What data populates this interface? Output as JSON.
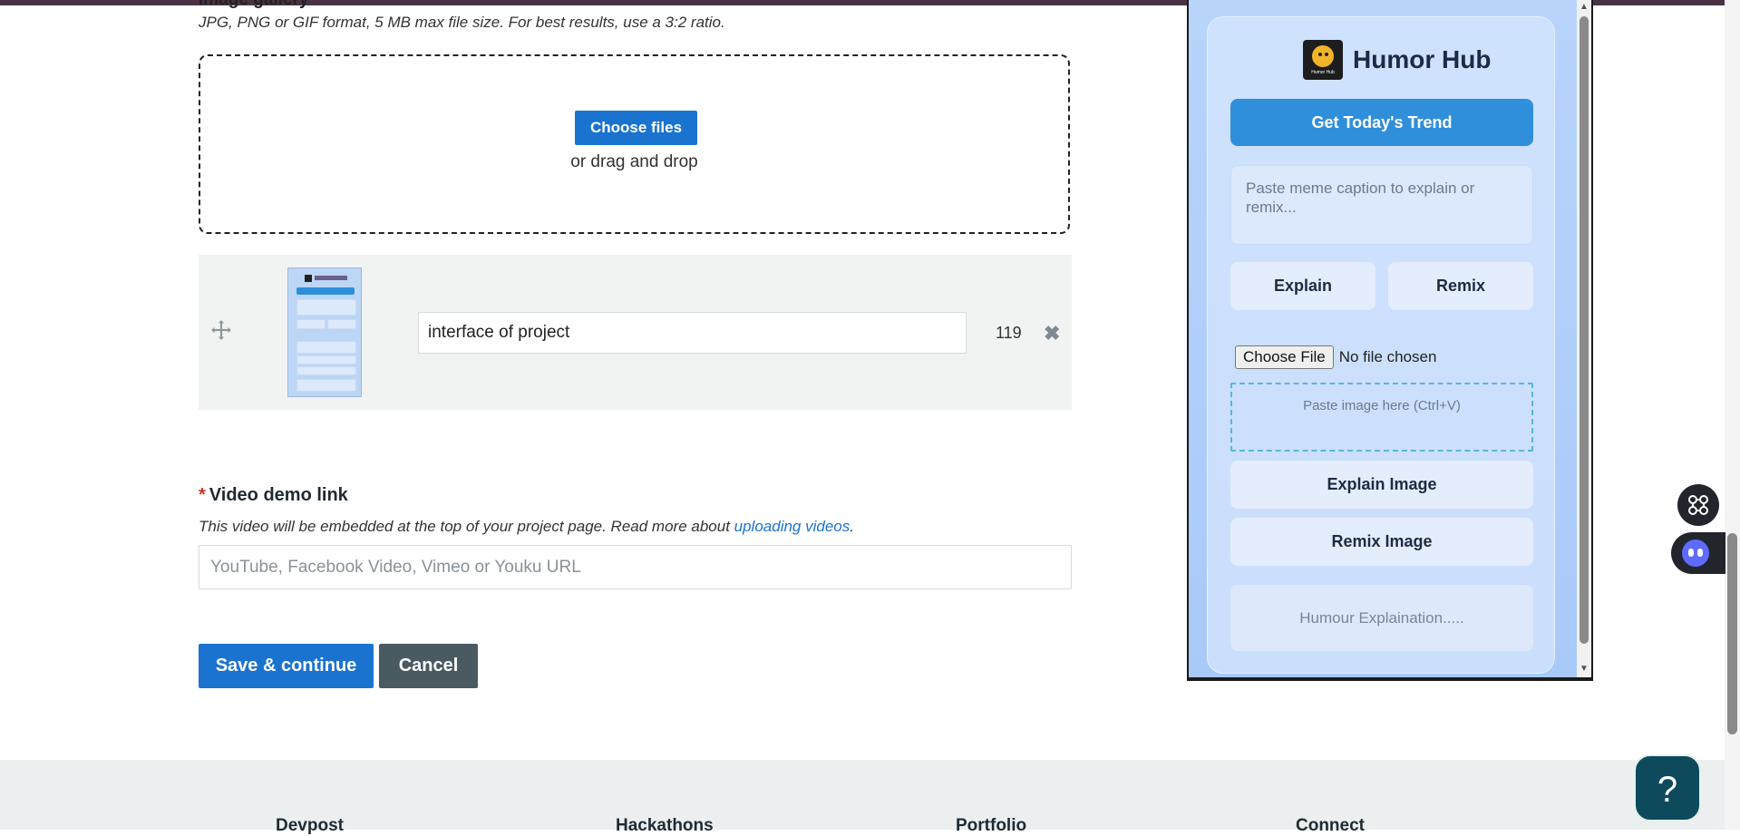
{
  "form": {
    "image_hint": "JPG, PNG or GIF format, 5 MB max file size. For best results, use a 3:2 ratio.",
    "choose_files_label": "Choose files",
    "drag_text": "or drag and drop",
    "image_item": {
      "caption": "interface of  project",
      "char_count": "119"
    },
    "video": {
      "required_mark": "*",
      "label": "Video demo link",
      "hint_prefix": "This video will be embedded at the top of your project page. Read more about ",
      "hint_link": "uploading videos",
      "hint_suffix": ".",
      "placeholder": "YouTube, Facebook Video, Vimeo or Youku URL"
    },
    "save_label": "Save & continue",
    "cancel_label": "Cancel"
  },
  "footer": {
    "columns": [
      "Devpost",
      "Hackathons",
      "Portfolio",
      "Connect"
    ]
  },
  "extension": {
    "logo_text": "Humor Hub",
    "title": "Humor Hub",
    "trend_button": "Get Today's Trend",
    "caption_placeholder": "Paste meme caption to explain or remix...",
    "explain_button": "Explain",
    "remix_button": "Remix",
    "file_button": "Choose File",
    "file_status": "No file chosen",
    "paste_zone": "Paste image here (Ctrl+V)",
    "explain_image_button": "Explain Image",
    "remix_image_button": "Remix Image",
    "output_placeholder": "Humour Explaination....."
  },
  "help_button": "?",
  "colors": {
    "primary": "#1b73d0",
    "cancel": "#4a5a61",
    "extension_bg": "#b8d4fb",
    "trend_button": "#2f8fdb",
    "help_button": "#0d4a5c"
  },
  "icons": [
    "move-icon",
    "remove-icon",
    "command-icon",
    "bot-icon",
    "help-icon"
  ]
}
